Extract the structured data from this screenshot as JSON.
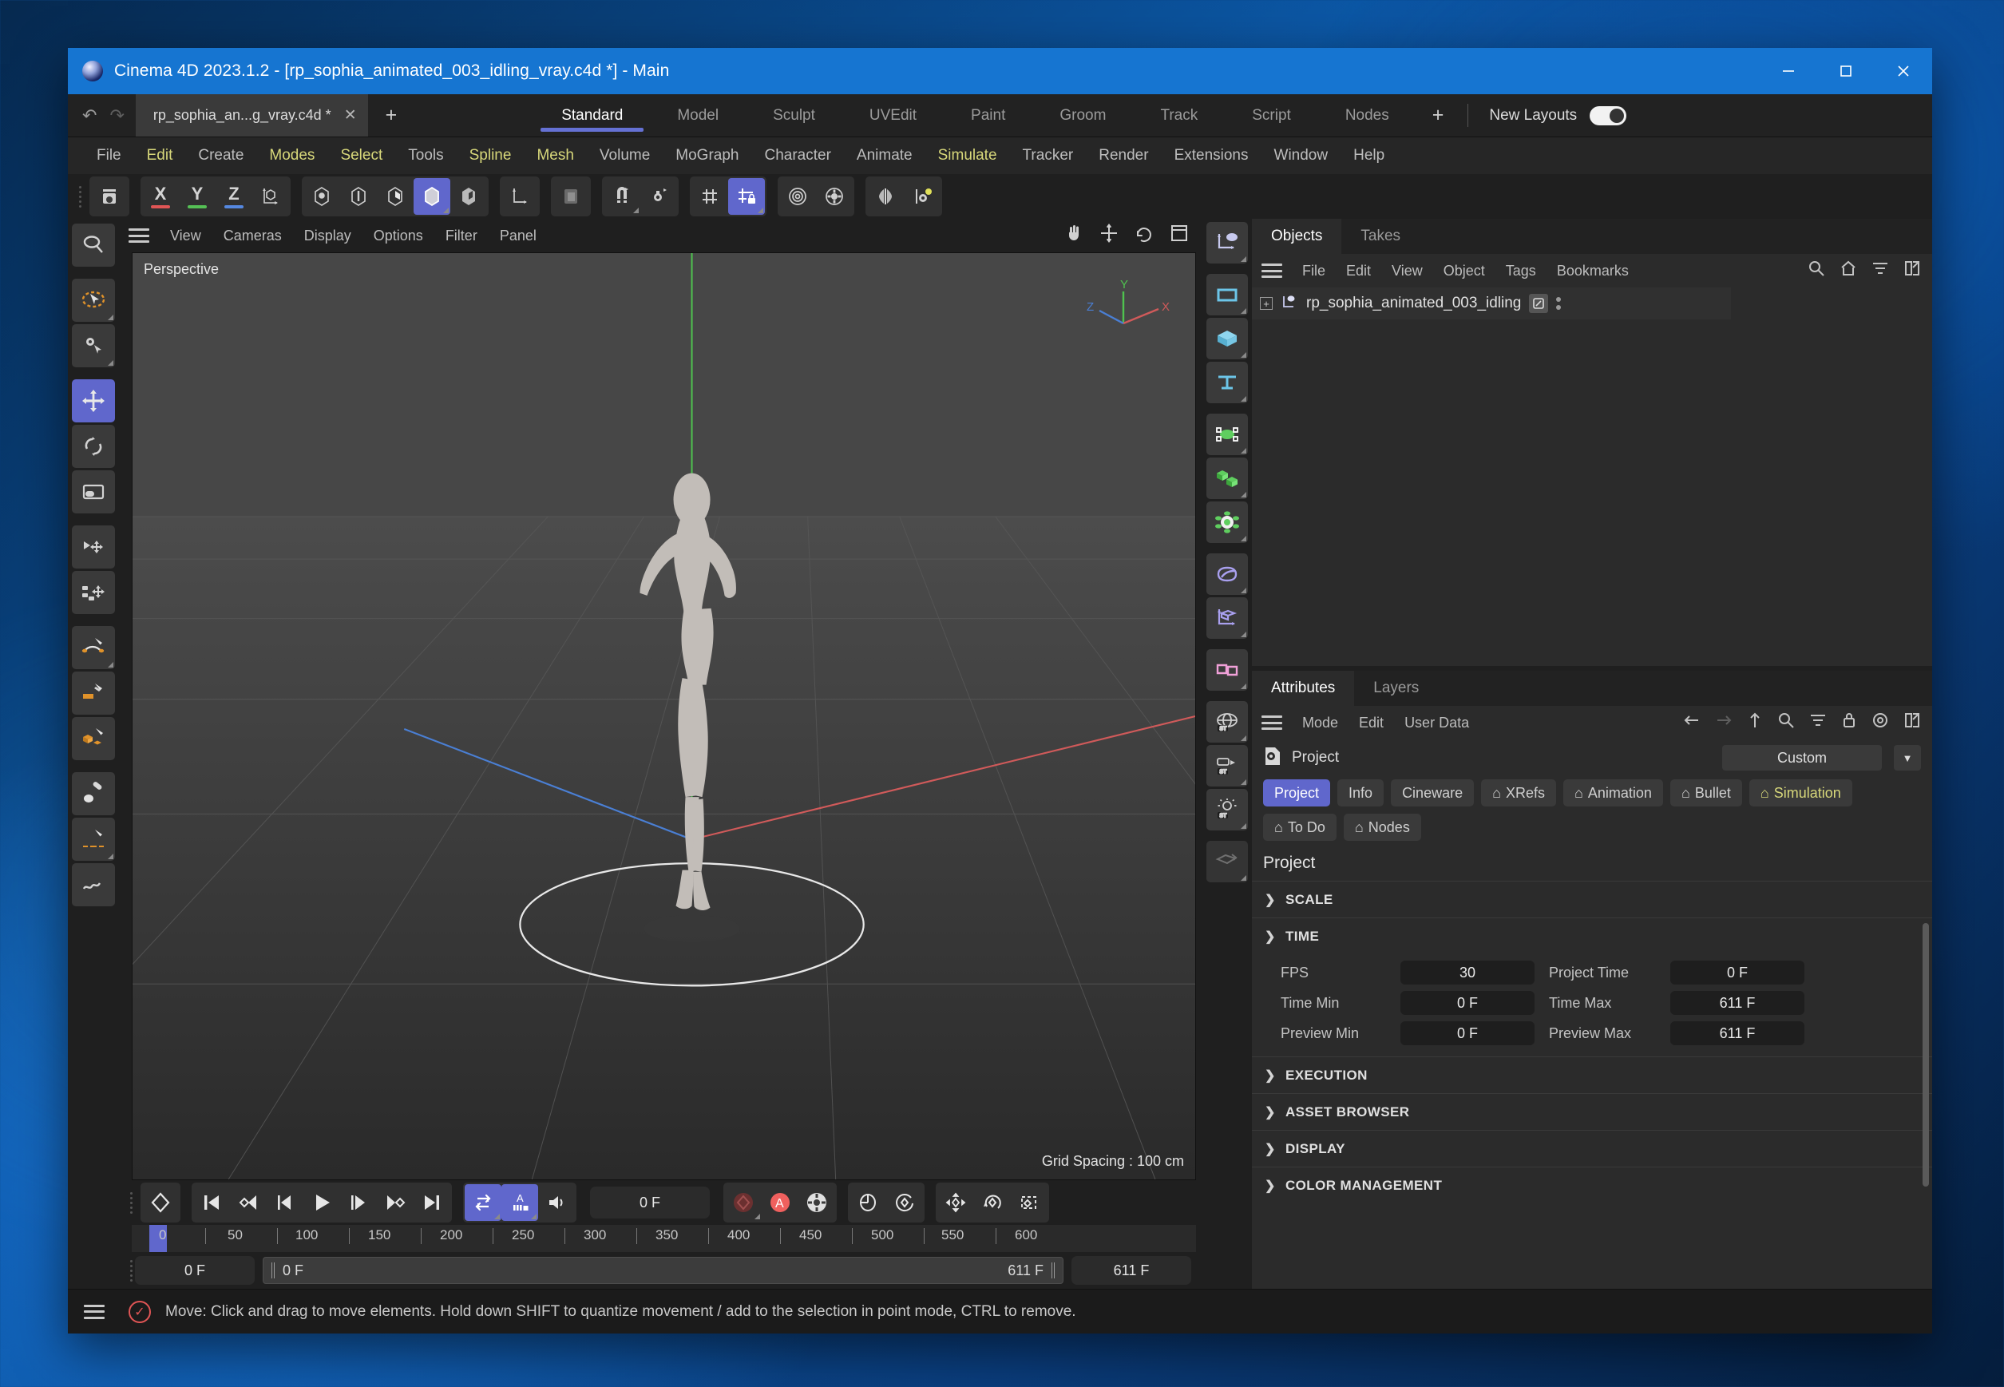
{
  "window": {
    "title": "Cinema 4D 2023.1.2 - [rp_sophia_animated_003_idling_vray.c4d *] - Main",
    "minimize": "─",
    "maximize": "☐",
    "close": "✕"
  },
  "tabbar": {
    "undo_icon": "↶",
    "redo_icon": "↷",
    "document_tab": "rp_sophia_an...g_vray.c4d *",
    "document_tab_close": "✕",
    "new_document": "+",
    "layout_tabs": [
      {
        "label": "Standard",
        "active": true
      },
      {
        "label": "Model",
        "active": false
      },
      {
        "label": "Sculpt",
        "active": false
      },
      {
        "label": "UVEdit",
        "active": false
      },
      {
        "label": "Paint",
        "active": false
      },
      {
        "label": "Groom",
        "active": false
      },
      {
        "label": "Track",
        "active": false
      },
      {
        "label": "Script",
        "active": false
      },
      {
        "label": "Nodes",
        "active": false
      }
    ],
    "layout_add": "+",
    "new_layouts_label": "New Layouts"
  },
  "menubar": [
    {
      "label": "File",
      "highlight": false
    },
    {
      "label": "Edit",
      "highlight": true
    },
    {
      "label": "Create",
      "highlight": false
    },
    {
      "label": "Modes",
      "highlight": true
    },
    {
      "label": "Select",
      "highlight": true
    },
    {
      "label": "Tools",
      "highlight": false
    },
    {
      "label": "Spline",
      "highlight": true
    },
    {
      "label": "Mesh",
      "highlight": true
    },
    {
      "label": "Volume",
      "highlight": false
    },
    {
      "label": "MoGraph",
      "highlight": false
    },
    {
      "label": "Character",
      "highlight": false
    },
    {
      "label": "Animate",
      "highlight": false
    },
    {
      "label": "Simulate",
      "highlight": true
    },
    {
      "label": "Tracker",
      "highlight": false
    },
    {
      "label": "Render",
      "highlight": false
    },
    {
      "label": "Extensions",
      "highlight": false
    },
    {
      "label": "Window",
      "highlight": false
    },
    {
      "label": "Help",
      "highlight": false
    }
  ],
  "viewport": {
    "menu": [
      "View",
      "Cameras",
      "Display",
      "Options",
      "Filter",
      "Panel"
    ],
    "label": "Perspective",
    "grid_spacing": "Grid Spacing : 100 cm",
    "axis_labels": {
      "x": "X",
      "y": "Y",
      "z": "Z"
    }
  },
  "objects_panel": {
    "tabs": [
      {
        "label": "Objects",
        "active": true
      },
      {
        "label": "Takes",
        "active": false
      }
    ],
    "menu": [
      "File",
      "Edit",
      "View",
      "Object",
      "Tags",
      "Bookmarks"
    ],
    "object_name": "rp_sophia_animated_003_idling"
  },
  "attributes_panel": {
    "tabs": [
      {
        "label": "Attributes",
        "active": true
      },
      {
        "label": "Layers",
        "active": false
      }
    ],
    "menu": [
      "Mode",
      "Edit",
      "User Data"
    ],
    "object_label": "Project",
    "preset_value": "Custom",
    "attr_tabs": [
      {
        "label": "Project",
        "active": true,
        "bell": false,
        "yellow": false
      },
      {
        "label": "Info",
        "active": false,
        "bell": false,
        "yellow": false
      },
      {
        "label": "Cineware",
        "active": false,
        "bell": false,
        "yellow": false
      },
      {
        "label": "XRefs",
        "active": false,
        "bell": true,
        "yellow": false
      },
      {
        "label": "Animation",
        "active": false,
        "bell": true,
        "yellow": false
      },
      {
        "label": "Bullet",
        "active": false,
        "bell": true,
        "yellow": false
      },
      {
        "label": "Simulation",
        "active": false,
        "bell": true,
        "yellow": true
      },
      {
        "label": "To Do",
        "active": false,
        "bell": true,
        "yellow": false
      },
      {
        "label": "Nodes",
        "active": false,
        "bell": true,
        "yellow": false
      }
    ],
    "section_title": "Project",
    "sections": [
      {
        "label": "SCALE",
        "expanded": false
      },
      {
        "label": "TIME",
        "expanded": true
      },
      {
        "label": "EXECUTION",
        "expanded": false
      },
      {
        "label": "ASSET BROWSER",
        "expanded": false
      },
      {
        "label": "DISPLAY",
        "expanded": false
      },
      {
        "label": "COLOR MANAGEMENT",
        "expanded": false
      }
    ],
    "time_fields": [
      {
        "label1": "FPS",
        "value1": "30",
        "label2": "Project Time",
        "value2": "0 F"
      },
      {
        "label1": "Time Min",
        "value1": "0 F",
        "label2": "Time Max",
        "value2": "611 F"
      },
      {
        "label1": "Preview Min",
        "value1": "0 F",
        "label2": "Preview Max",
        "value2": "611 F"
      }
    ]
  },
  "timeline": {
    "current_frame_field": "0 F",
    "start_frame_field": "0 F",
    "range_start": "0 F",
    "range_end": "611 F",
    "end_frame_field": "611 F",
    "ticks": [
      "0",
      "50",
      "100",
      "150",
      "200",
      "250",
      "300",
      "350",
      "400",
      "450",
      "500",
      "550",
      "600"
    ],
    "autokey_letter": "A"
  },
  "statusbar": {
    "message": "Move: Click and drag to move elements. Hold down SHIFT to quantize movement / add to the selection in point mode, CTRL to remove."
  },
  "colors": {
    "accent_blue": "#6067cc",
    "title_blue": "#1675d1",
    "menu_highlight": "#d7d77a",
    "record_red": "#f0605e",
    "axis_x": "#e05555",
    "axis_y": "#55c055",
    "axis_z": "#5588e0"
  }
}
